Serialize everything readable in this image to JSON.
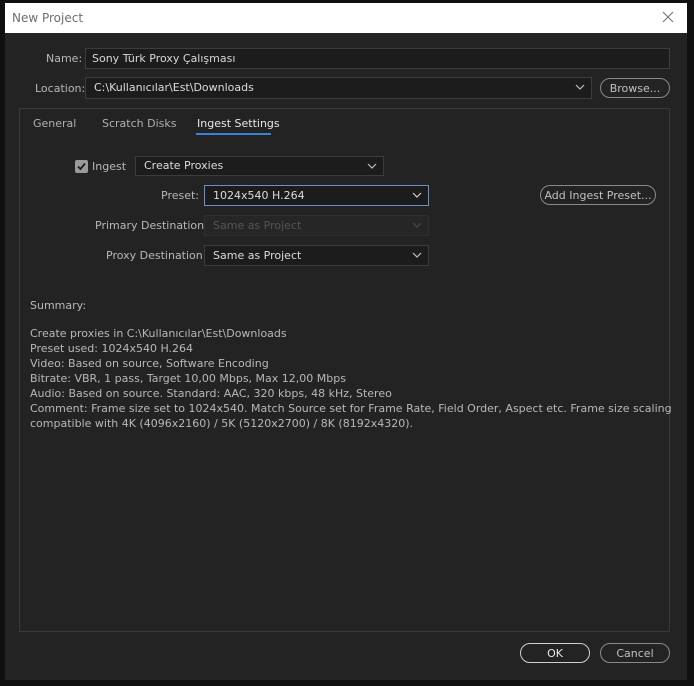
{
  "window": {
    "title": "New Project"
  },
  "name": {
    "label": "Name:",
    "value": "Sony Türk Proxy Çalışması"
  },
  "location": {
    "label": "Location:",
    "value": "C:\\Kullanıcılar\\Est\\Downloads",
    "browse_label": "Browse..."
  },
  "tabs": [
    {
      "label": "General"
    },
    {
      "label": "Scratch Disks"
    },
    {
      "label": "Ingest Settings"
    }
  ],
  "active_tab": "Ingest Settings",
  "ingest": {
    "checkbox_label": "Ingest",
    "checked": true,
    "mode": "Create Proxies",
    "preset_label": "Preset:",
    "preset_value": "1024x540 H.264",
    "add_preset_label": "Add Ingest Preset...",
    "primary_destination_label": "Primary Destination:",
    "primary_destination_value": "Same as Project",
    "proxy_destination_label": "Proxy Destination:",
    "proxy_destination_value": "Same as Project"
  },
  "summary": {
    "heading": "Summary:",
    "lines": [
      "Create proxies in C:\\Kullanıcılar\\Est\\Downloads",
      "Preset used: 1024x540 H.264",
      "Video: Based on source, Software Encoding",
      "Bitrate: VBR, 1 pass, Target 10,00 Mbps, Max 12,00 Mbps",
      "Audio: Based on source. Standard: AAC, 320 kbps, 48 kHz, Stereo",
      "Comment: Frame size set to 1024x540. Match Source set for Frame Rate, Field Order, Aspect etc. Frame size scaling",
      "compatible with 4K (4096x2160) / 5K (5120x2700) / 8K (8192x4320)."
    ]
  },
  "footer": {
    "ok_label": "OK",
    "cancel_label": "Cancel"
  },
  "colors": {
    "accent": "#3b82d6",
    "background": "#232323",
    "titlebar": "#ffffff"
  }
}
